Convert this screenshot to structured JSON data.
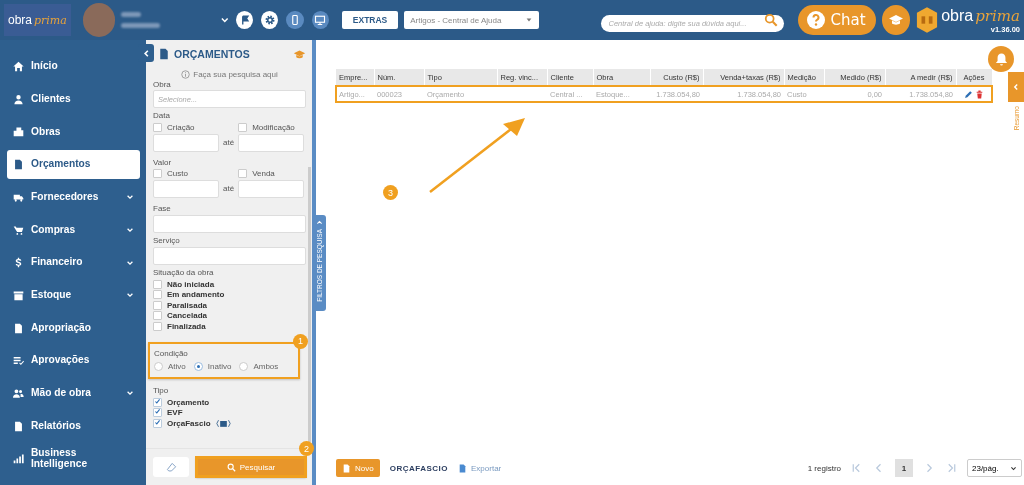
{
  "header": {
    "logo": {
      "word": "obra",
      "script": "prima"
    },
    "extras_button": "EXTRAS",
    "help_select": "Artigos - Central de Ajuda",
    "help_search": {
      "placeholder": "Central de ajuda: digite sua dúvida aqui..."
    },
    "chat_button": "Chat",
    "brand": {
      "word": "obra",
      "script": "prima",
      "version": "v1.36.00"
    }
  },
  "sidebar": {
    "items": [
      {
        "label": "Início",
        "kind": "home",
        "expandable": false,
        "selected": false
      },
      {
        "label": "Clientes",
        "kind": "user",
        "expandable": false,
        "selected": false
      },
      {
        "label": "Obras",
        "kind": "building",
        "expandable": false,
        "selected": false
      },
      {
        "label": "Orçamentos",
        "kind": "budget",
        "expandable": false,
        "selected": true
      },
      {
        "label": "Fornecedores",
        "kind": "truck",
        "expandable": true,
        "selected": false
      },
      {
        "label": "Compras",
        "kind": "cart",
        "expandable": true,
        "selected": false
      },
      {
        "label": "Financeiro",
        "kind": "dollar",
        "expandable": true,
        "selected": false
      },
      {
        "label": "Estoque",
        "kind": "box",
        "expandable": true,
        "selected": false
      },
      {
        "label": "Apropriação",
        "kind": "doc-check",
        "expandable": false,
        "selected": false
      },
      {
        "label": "Aprovações",
        "kind": "list-check",
        "expandable": false,
        "selected": false
      },
      {
        "label": "Mão de obra",
        "kind": "users",
        "expandable": true,
        "selected": false
      },
      {
        "label": "Relatórios",
        "kind": "report",
        "expandable": false,
        "selected": false
      },
      {
        "label": "Business Intelligence",
        "kind": "bars",
        "expandable": false,
        "selected": false
      }
    ]
  },
  "filters": {
    "title": "ORÇAMENTOS",
    "hint": "Faça sua pesquisa aqui",
    "obra": {
      "label": "Obra",
      "placeholder": "Selecione..."
    },
    "data": {
      "label": "Data",
      "from": {
        "label": "Criação",
        "checked": false
      },
      "to": {
        "label": "Modificação",
        "checked": false
      },
      "between": "até"
    },
    "valor": {
      "label": "Valor",
      "from": {
        "label": "Custo",
        "checked": false
      },
      "to": {
        "label": "Venda",
        "checked": false
      },
      "between": "até"
    },
    "fase": {
      "label": "Fase"
    },
    "servico": {
      "label": "Serviço"
    },
    "situacao": {
      "label": "Situação da obra",
      "options": [
        {
          "label": "Não iniciada",
          "checked": false
        },
        {
          "label": "Em andamento",
          "checked": false
        },
        {
          "label": "Paralisada",
          "checked": false
        },
        {
          "label": "Cancelada",
          "checked": false
        },
        {
          "label": "Finalizada",
          "checked": false
        }
      ]
    },
    "condicao": {
      "label": "Condição",
      "callout": "1",
      "options": [
        {
          "label": "Ativo",
          "selected": false
        },
        {
          "label": "Inativo",
          "selected": true
        },
        {
          "label": "Ambos",
          "selected": false
        }
      ]
    },
    "tipo": {
      "label": "Tipo",
      "options": [
        {
          "label": "Orçamento",
          "checked": true,
          "logo": false
        },
        {
          "label": "EVF",
          "checked": true,
          "logo": false
        },
        {
          "label": "OrçaFascio",
          "checked": true,
          "logo": true
        }
      ]
    },
    "search_button": {
      "label": "Pesquisar",
      "callout": "2"
    },
    "panel_tab": "FILTROS DE PESQUISA"
  },
  "table": {
    "callout": "3",
    "columns": [
      {
        "label": "Empre...",
        "kind": "text"
      },
      {
        "label": "Núm.",
        "kind": "text"
      },
      {
        "label": "Tipo",
        "kind": "text"
      },
      {
        "label": "Reg. vinc...",
        "kind": "text"
      },
      {
        "label": "Cliente",
        "kind": "text"
      },
      {
        "label": "Obra",
        "kind": "text"
      },
      {
        "label": "Custo (R$)",
        "kind": "money"
      },
      {
        "label": "Venda+taxas (R$)",
        "kind": "money"
      },
      {
        "label": "Medição",
        "kind": "text"
      },
      {
        "label": "Medido (R$)",
        "kind": "money"
      },
      {
        "label": "A medir (R$)",
        "kind": "money"
      },
      {
        "label": "Ações",
        "kind": "actions"
      }
    ],
    "rows": [
      [
        "Artigo...",
        "000023",
        "Orçamento",
        "",
        "Central ...",
        "Estoque...",
        "1.738.054,80",
        "1.738.054,80",
        "Custo",
        "0,00",
        "1.738.054,80"
      ]
    ]
  },
  "resumo_tab": "Resumo",
  "footer": {
    "new_button": "Novo",
    "partner_logo": "ORÇAFASCIO",
    "export_link": "Exportar",
    "count": "1 registro",
    "pages": [
      {
        "label": "1",
        "selected": true
      }
    ],
    "page_size": "23/pág."
  }
}
